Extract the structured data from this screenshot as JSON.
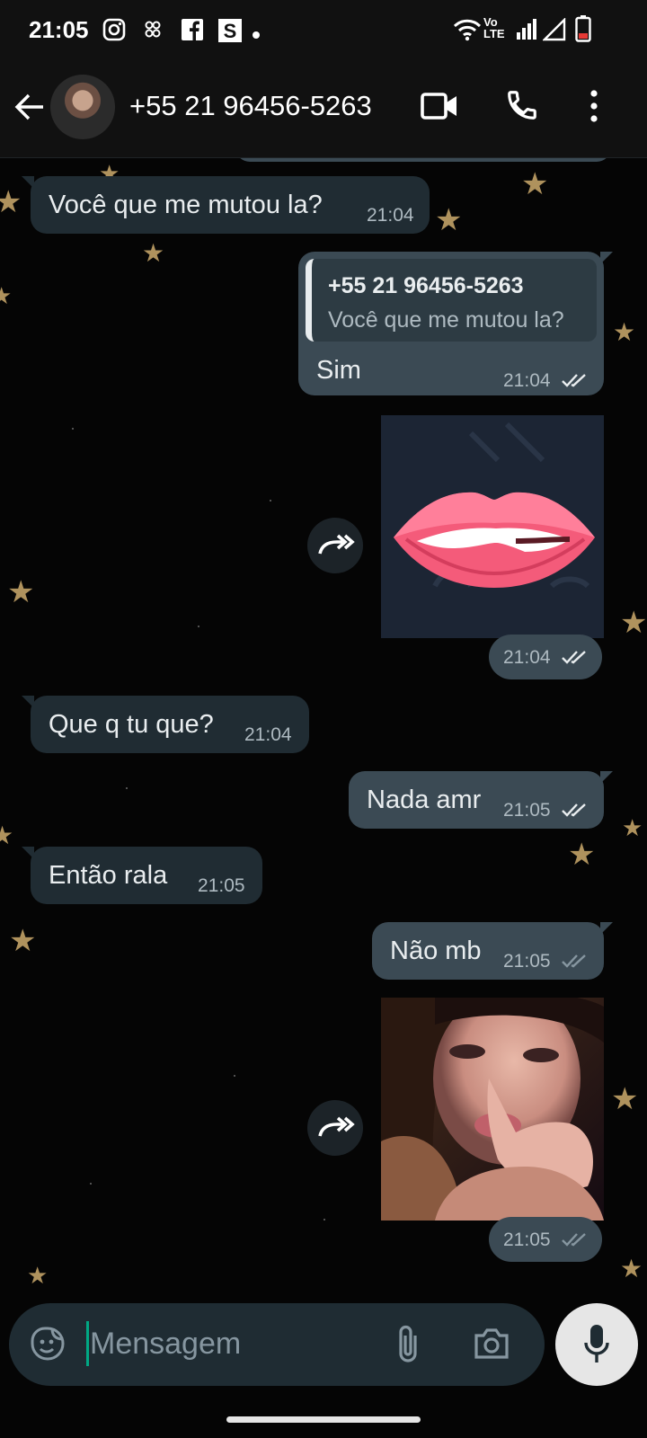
{
  "status_bar": {
    "time": "21:05",
    "icons": [
      "instagram-icon",
      "app-icon",
      "facebook-icon",
      "s-app-icon",
      "dot-icon",
      "wifi-icon",
      "volte-icon",
      "signal-icon",
      "signal-empty-icon",
      "battery-icon"
    ],
    "volte_label": "Vo LTE"
  },
  "header": {
    "contact_name": "+55 21 96456-5263",
    "icons": [
      "back-arrow-icon",
      "video-call-icon",
      "phone-icon",
      "more-vert-icon"
    ]
  },
  "messages": [
    {
      "direction": "incoming",
      "text": "Você que me mutou la?",
      "time": "21:04"
    },
    {
      "direction": "outgoing",
      "quote_name": "+55 21 96456-5263",
      "quote_text": "Você que me mutou la?",
      "text": "Sim",
      "time": "21:04",
      "read": true
    },
    {
      "direction": "outgoing",
      "type": "image",
      "image": "lips-sticker",
      "time": "21:04",
      "read": true
    },
    {
      "direction": "incoming",
      "text": "Que q tu que?",
      "time": "21:04"
    },
    {
      "direction": "outgoing",
      "text": "Nada amr",
      "time": "21:05",
      "read": true
    },
    {
      "direction": "incoming",
      "text": "Então rala",
      "time": "21:05"
    },
    {
      "direction": "outgoing",
      "text": "Não mb",
      "time": "21:05",
      "read": false
    },
    {
      "direction": "outgoing",
      "type": "image",
      "image": "selfie-photo",
      "time": "21:05",
      "read": false
    }
  ],
  "composer": {
    "placeholder": "Mensagem",
    "icons": [
      "sticker-icon",
      "attach-icon",
      "camera-icon",
      "mic-icon"
    ]
  },
  "colors": {
    "incoming_bubble": "#202c33",
    "outgoing_bubble": "#3b4a54",
    "read_ticks": "#e9edef",
    "delivered_ticks": "#8696a0",
    "caret": "#00a884",
    "star": "#b99a62"
  }
}
